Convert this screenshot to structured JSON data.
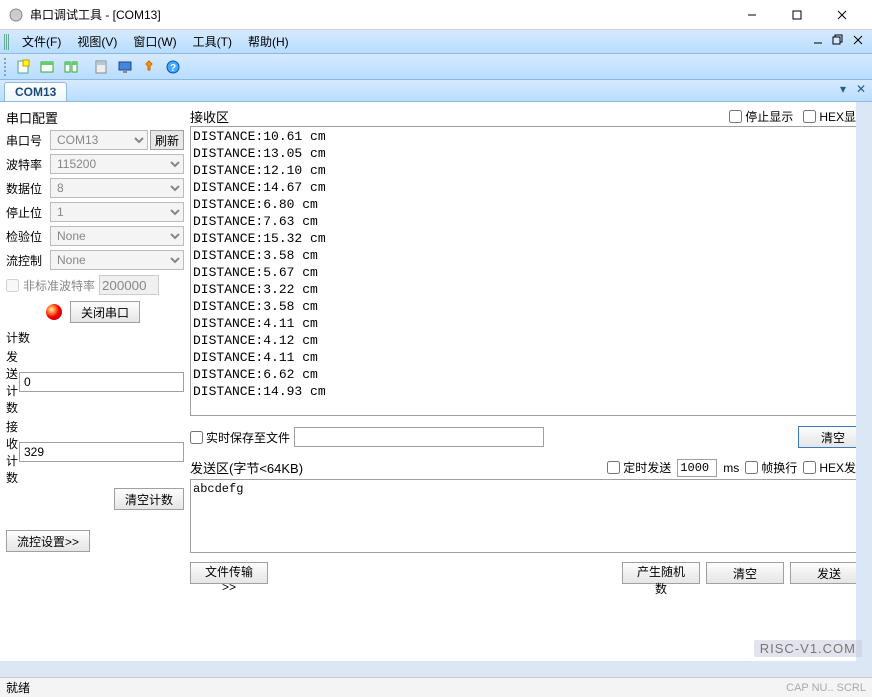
{
  "window": {
    "title": "串口调试工具 - [COM13]"
  },
  "menu": {
    "file": "文件(F)",
    "view": "视图(V)",
    "window": "窗口(W)",
    "tool": "工具(T)",
    "help": "帮助(H)"
  },
  "tab": {
    "label": "COM13"
  },
  "config": {
    "title": "串口配置",
    "port_label": "串口号",
    "port_value": "COM13",
    "refresh": "刷新",
    "baud_label": "波特率",
    "baud_value": "115200",
    "databits_label": "数据位",
    "databits_value": "8",
    "stopbits_label": "停止位",
    "stopbits_value": "1",
    "parity_label": "检验位",
    "parity_value": "None",
    "flow_label": "流控制",
    "flow_value": "None",
    "nonstd_baud_label": "非标准波特率",
    "nonstd_baud_value": "200000",
    "close_port": "关闭串口"
  },
  "count": {
    "title": "计数",
    "send_label": "发送计数",
    "send_value": "0",
    "recv_label": "接收计数",
    "recv_value": "329",
    "clear": "清空计数"
  },
  "flow_settings": "流控设置>>",
  "recv": {
    "title": "接收区",
    "stop_display": "停止显示",
    "hex_display": "HEX显示",
    "lines": [
      "DISTANCE:10.61 cm",
      "DISTANCE:13.05 cm",
      "DISTANCE:12.10 cm",
      "DISTANCE:14.67 cm",
      "DISTANCE:6.80 cm",
      "DISTANCE:7.63 cm",
      "DISTANCE:15.32 cm",
      "DISTANCE:3.58 cm",
      "DISTANCE:5.67 cm",
      "DISTANCE:3.22 cm",
      "DISTANCE:3.58 cm",
      "DISTANCE:4.11 cm",
      "DISTANCE:4.12 cm",
      "DISTANCE:4.11 cm",
      "DISTANCE:6.62 cm",
      "DISTANCE:14.93 cm"
    ],
    "save_to_file": "实时保存至文件",
    "clear": "清空"
  },
  "send": {
    "title": "发送区(字节<64KB)",
    "timed_send": "定时发送",
    "interval": "1000",
    "ms": "ms",
    "wrap": "帧换行",
    "hex_send": "HEX发送",
    "content": "abcdefg",
    "file_transfer": "文件传输>>",
    "gen_random": "产生随机数",
    "clear": "清空",
    "send_btn": "发送"
  },
  "status": {
    "ready": "就绪",
    "caps": "CAP  NU..  SCRL"
  },
  "watermark": "RISC-V1.COM"
}
